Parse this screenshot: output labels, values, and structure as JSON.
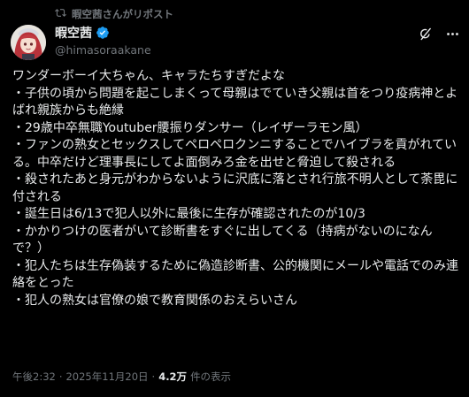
{
  "repost": {
    "text": "暇空茜さんがリポスト",
    "icon": "repost-icon"
  },
  "author": {
    "display_name": "暇空茜",
    "handle": "@himasoraakane",
    "verified": true,
    "verified_color": "#1d9bf0"
  },
  "actions": {
    "grok_icon": "grok-icon",
    "more_icon": "more-icon"
  },
  "body": "ワンダーボーイ大ちゃん、キャラたちすぎだよな\n・子供の頃から問題を起こしまくって母親はでていき父親は首をつり疫病神とよばれ親族からも絶縁\n・29歳中卒無職Youtuber腰振りダンサー（レイザーラモン風）\n・ファンの熟女とセックスしてペロペロクンニすることでハイブラを貢がれている。中卒だけど理事長にしてよ面倒みろ金を出せと脅迫して殺される\n・殺されたあと身元がわからないように沢底に落とされ行旅不明人として荼毘に付される\n・誕生日は6/13で犯人以外に最後に生存が確認されたのが10/3\n・かかりつけの医者がいて診断書をすぐに出してくる（持病がないのになんで？）\n・犯人たちは生存偽装するために偽造診断書、公的機関にメールや電話でのみ連絡をとった\n・犯人の熟女は官僚の娘で教育関係のおえらいさん",
  "meta": {
    "time": "午後2:32",
    "date": "2025年11月20日",
    "separator": "·",
    "views_count": "4.2万",
    "views_label": "件の表示"
  },
  "colors": {
    "background": "#000000",
    "text": "#e7e9ea",
    "secondary": "#71767b"
  }
}
